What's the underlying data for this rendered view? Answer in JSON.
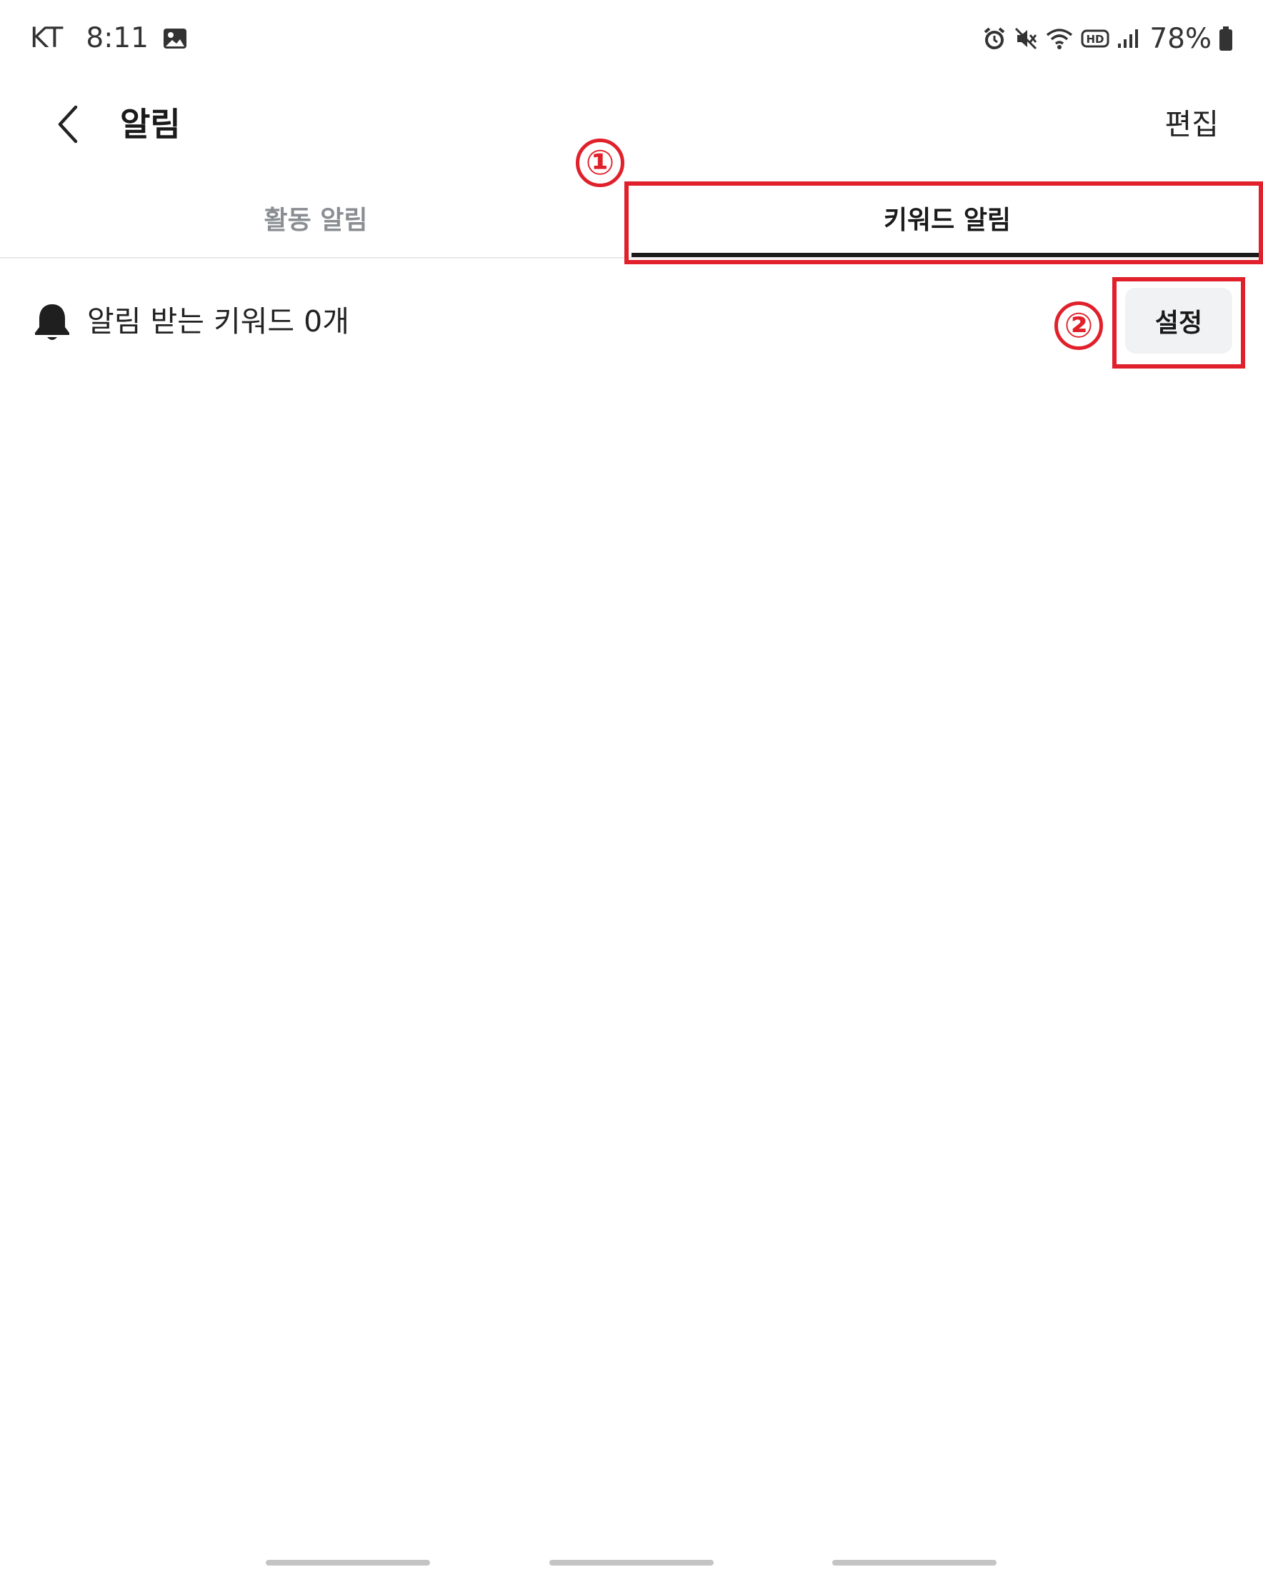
{
  "status_bar": {
    "carrier": "KT",
    "time": "8:11",
    "battery": "78%",
    "icons": [
      "gallery-icon",
      "alarm-icon",
      "mute-icon",
      "wifi-icon",
      "hd-icon",
      "signal-icon",
      "battery-icon"
    ]
  },
  "app_bar": {
    "title": "알림",
    "edit_label": "편집"
  },
  "tabs": [
    {
      "label": "활동 알림",
      "active": false
    },
    {
      "label": "키워드 알림",
      "active": true
    }
  ],
  "keyword_row": {
    "text": "알림 받는 키워드 0개",
    "settings_label": "설정"
  },
  "annotations": {
    "marker_1": "①",
    "marker_2": "②",
    "color": "#e0202a"
  },
  "colors": {
    "accent_text": "#1a1a1a",
    "inactive_tab": "#8a8d91",
    "button_bg": "#f1f2f4"
  }
}
